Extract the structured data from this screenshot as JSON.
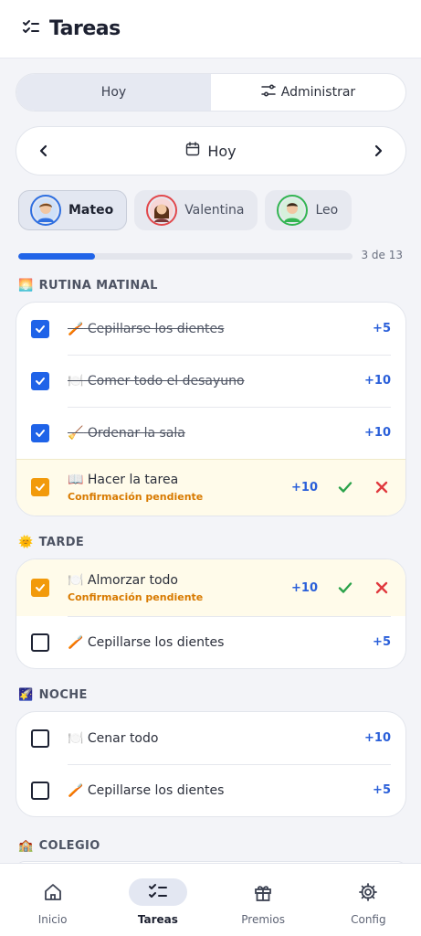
{
  "header": {
    "title": "Tareas",
    "icon": "checklist-icon"
  },
  "segment": {
    "today": "Hoy",
    "manage": "Administrar"
  },
  "date_nav": {
    "label": "Hoy"
  },
  "kids": [
    {
      "name": "Mateo",
      "color": "#2f6fe0",
      "active": true
    },
    {
      "name": "Valentina",
      "color": "#e2484c",
      "active": false
    },
    {
      "name": "Leo",
      "color": "#33b552",
      "active": false
    }
  ],
  "progress": {
    "text": "3 de 13",
    "fraction": 0.23
  },
  "sections": [
    {
      "emoji": "🌅",
      "title": "RUTINA MATINAL",
      "tasks": [
        {
          "emoji": "🪥",
          "name": "Cepillarse los dientes",
          "points": "+5",
          "state": "done"
        },
        {
          "emoji": "🍽️",
          "name": "Comer todo el desayuno",
          "points": "+10",
          "state": "done"
        },
        {
          "emoji": "🧹",
          "name": "Ordenar la sala",
          "points": "+10",
          "state": "done"
        },
        {
          "emoji": "📖",
          "name": "Hacer la tarea",
          "points": "+10",
          "state": "pending",
          "sub": "Confirmación pendiente"
        }
      ]
    },
    {
      "emoji": "🌞",
      "title": "TARDE",
      "tasks": [
        {
          "emoji": "🍽️",
          "name": "Almorzar todo",
          "points": "+10",
          "state": "pending",
          "sub": "Confirmación pendiente"
        },
        {
          "emoji": "🪥",
          "name": "Cepillarse los dientes",
          "points": "+5",
          "state": "todo"
        }
      ]
    },
    {
      "emoji": "🌠",
      "title": "NOCHE",
      "tasks": [
        {
          "emoji": "🍽️",
          "name": "Cenar todo",
          "points": "+10",
          "state": "todo"
        },
        {
          "emoji": "🪥",
          "name": "Cepillarse los dientes",
          "points": "+5",
          "state": "todo"
        }
      ]
    },
    {
      "emoji": "🏫",
      "title": "COLEGIO",
      "tasks": []
    }
  ],
  "bottom_nav": [
    {
      "label": "Inicio",
      "icon": "home-icon",
      "active": false
    },
    {
      "label": "Tareas",
      "icon": "tasks-icon",
      "active": true
    },
    {
      "label": "Premios",
      "icon": "gift-icon",
      "active": false
    },
    {
      "label": "Config",
      "icon": "gear-icon",
      "active": false
    }
  ],
  "colors": {
    "accent": "#1f63e8",
    "pending": "#f29a0b",
    "confirm": "#2aa24a",
    "reject": "#e0393e"
  }
}
